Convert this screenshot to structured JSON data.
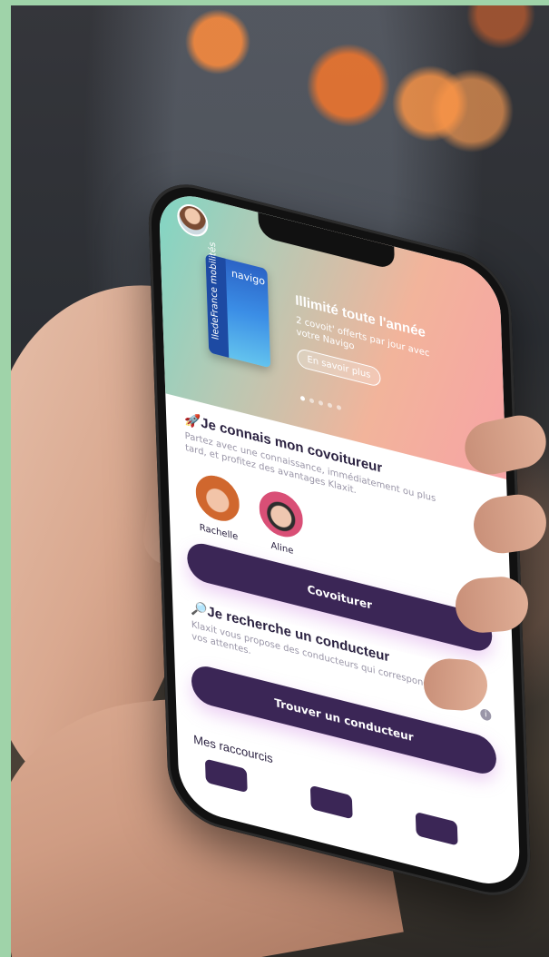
{
  "promo": {
    "card_brand": "navigo",
    "card_issuer": "IledeFrance mobilités",
    "title": "Illimité toute l'année",
    "subtitle": "2 covoit' offerts par jour avec votre Navigo",
    "button": "En savoir plus",
    "carousel_pages": 5,
    "carousel_active": 1
  },
  "section_known": {
    "emoji": "🚀",
    "title": "Je connais mon covoitureur",
    "description": "Partez avec une connaissance, immédiatement ou plus tard, et profitez des avantages Klaxit.",
    "friends": [
      {
        "name": "Rachelle"
      },
      {
        "name": "Aline"
      }
    ],
    "button": "Covoiturer"
  },
  "section_search": {
    "emoji": "🔎",
    "title": "Je recherche un conducteur",
    "description": "Klaxit vous propose des conducteurs qui correspondent à vos attentes.",
    "button": "Trouver un conducteur"
  },
  "shortcuts": {
    "title": "Mes raccourcis",
    "icons": [
      "chat-icon",
      "clock-route-icon",
      "calendar-icon"
    ]
  },
  "colors": {
    "primary": "#3b2656",
    "background_frame": "#9fd3a9"
  }
}
